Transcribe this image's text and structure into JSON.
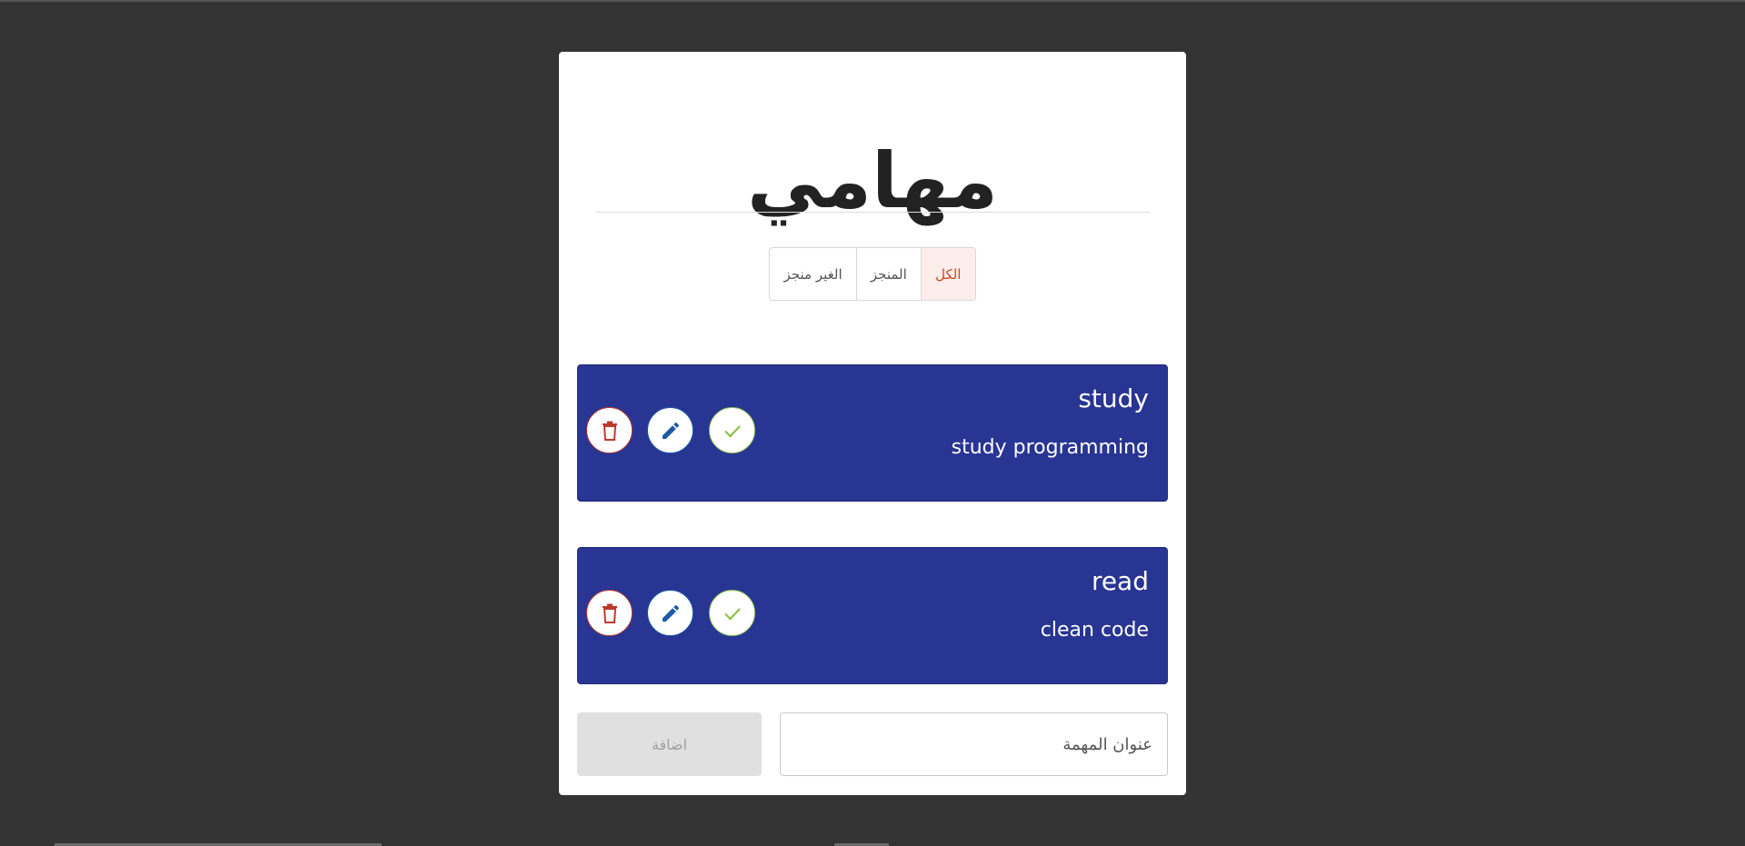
{
  "header": {
    "title": "مهامي"
  },
  "filters": {
    "all_label": "الكل",
    "done_label": "المنجز",
    "undone_label": "الغير منجز",
    "active": "all"
  },
  "tasks": [
    {
      "title": "study",
      "description": "study programming"
    },
    {
      "title": "read",
      "description": "clean code"
    }
  ],
  "add_form": {
    "input_placeholder": "عنوان المهمة",
    "input_value": "",
    "button_label": "اضافة"
  },
  "colors": {
    "background": "#333333",
    "task_bg": "#283593",
    "active_filter_text": "#c9481c",
    "delete": "#c0392b",
    "edit": "#1e5aa8",
    "check": "#8bc34a"
  },
  "icons": {
    "delete": "trash-icon",
    "edit": "pencil-icon",
    "done": "check-icon"
  }
}
